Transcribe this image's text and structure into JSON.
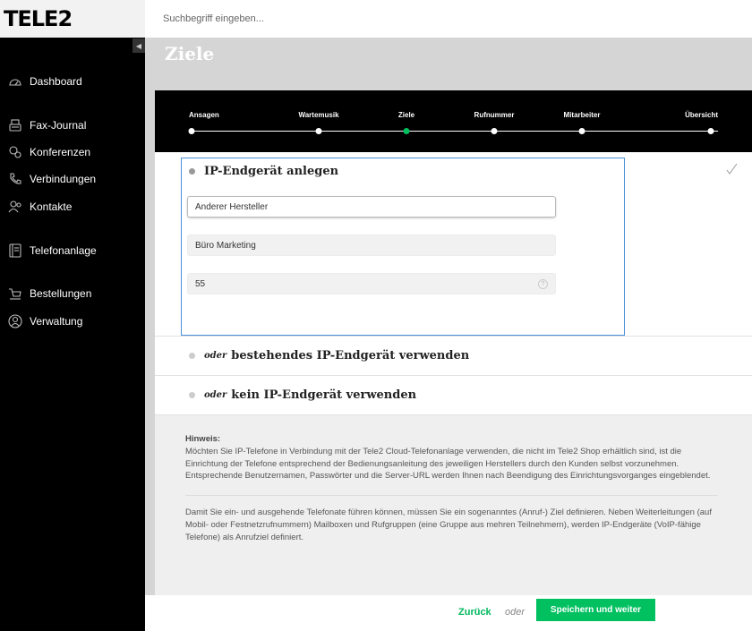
{
  "brand": {
    "logo": "TELE2"
  },
  "search": {
    "placeholder": "Suchbegriff eingeben..."
  },
  "sidebar": {
    "collapse_icon": "◀",
    "items": [
      {
        "label": "Dashboard",
        "icon": "dashboard-icon"
      },
      {
        "label": "Fax-Journal",
        "icon": "fax-icon"
      },
      {
        "label": "Konferenzen",
        "icon": "conference-icon"
      },
      {
        "label": "Verbindungen",
        "icon": "phone-icon"
      },
      {
        "label": "Kontakte",
        "icon": "contacts-icon"
      },
      {
        "label": "Telefonanlage",
        "icon": "phone-system-icon"
      },
      {
        "label": "Bestellungen",
        "icon": "cart-icon"
      },
      {
        "label": "Verwaltung",
        "icon": "admin-icon"
      }
    ]
  },
  "page": {
    "title": "Ziele"
  },
  "stepper": {
    "steps": [
      "Ansagen",
      "Wartemusik",
      "Ziele",
      "Rufnummer",
      "Mitarbeiter",
      "Übersicht"
    ],
    "active_index": 2
  },
  "options": {
    "create": {
      "title": "IP-Endgerät anlegen"
    },
    "existing": {
      "prefix": "oder",
      "title": "bestehendes IP-Endgerät verwenden"
    },
    "none": {
      "prefix": "oder",
      "title": "kein IP-Endgerät verwenden"
    }
  },
  "form": {
    "manufacturer": "Anderer Hersteller",
    "name": "Büro Marketing",
    "number": "55",
    "help_icon": "?"
  },
  "note": {
    "heading": "Hinweis:",
    "paragraph1": "Möchten Sie IP-Telefone in Verbindung mit der Tele2 Cloud-Telefonanlage verwenden, die nicht im Tele2 Shop erhältlich sind, ist die Einrichtung der Telefone entsprechend der Bedienungsanleitung des jeweiligen Herstellers durch den Kunden selbst vorzunehmen. Entsprechende Benutzernamen, Passwörter und die Server-URL werden Ihnen nach Beendigung des Einrichtungsvorganges eingeblendet.",
    "paragraph2": "Damit Sie ein- und ausgehende Telefonate führen können, müssen Sie ein sogenanntes (Anruf-) Ziel definieren. Neben Weiterleitungen (auf Mobil- oder Festnetzrufnummern) Mailboxen und Rufgruppen (eine Gruppe aus mehren Teilnehmern), werden IP-Endgeräte (VoIP-fähige Telefone) als Anrufziel definiert."
  },
  "footer": {
    "back": "Zurück",
    "or": "oder",
    "save": "Speichern und weiter"
  },
  "colors": {
    "accent": "#00c060",
    "highlight": "#4a90d9",
    "sidebar": "#000000"
  }
}
